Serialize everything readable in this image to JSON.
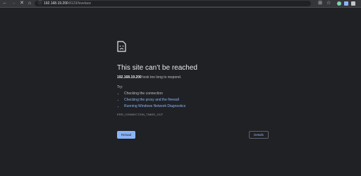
{
  "browser": {
    "url_host": "192.168.19.200",
    "url_rest": ":8123/lovelace"
  },
  "error_page": {
    "title": "This site can’t be reached",
    "host": "192.168.19.200",
    "message_rest": " took too long to respond.",
    "try_label": "Try:",
    "suggestions": [
      "Checking the connection",
      "Checking the proxy and the firewall",
      "Running Windows Network Diagnostics"
    ],
    "error_code": "ERR_CONNECTION_TIMED_OUT",
    "reload_label": "Reload",
    "details_label": "Details"
  },
  "colors": {
    "background": "#202124",
    "accent": "#8ab4f8",
    "toolbar": "#35363a"
  }
}
